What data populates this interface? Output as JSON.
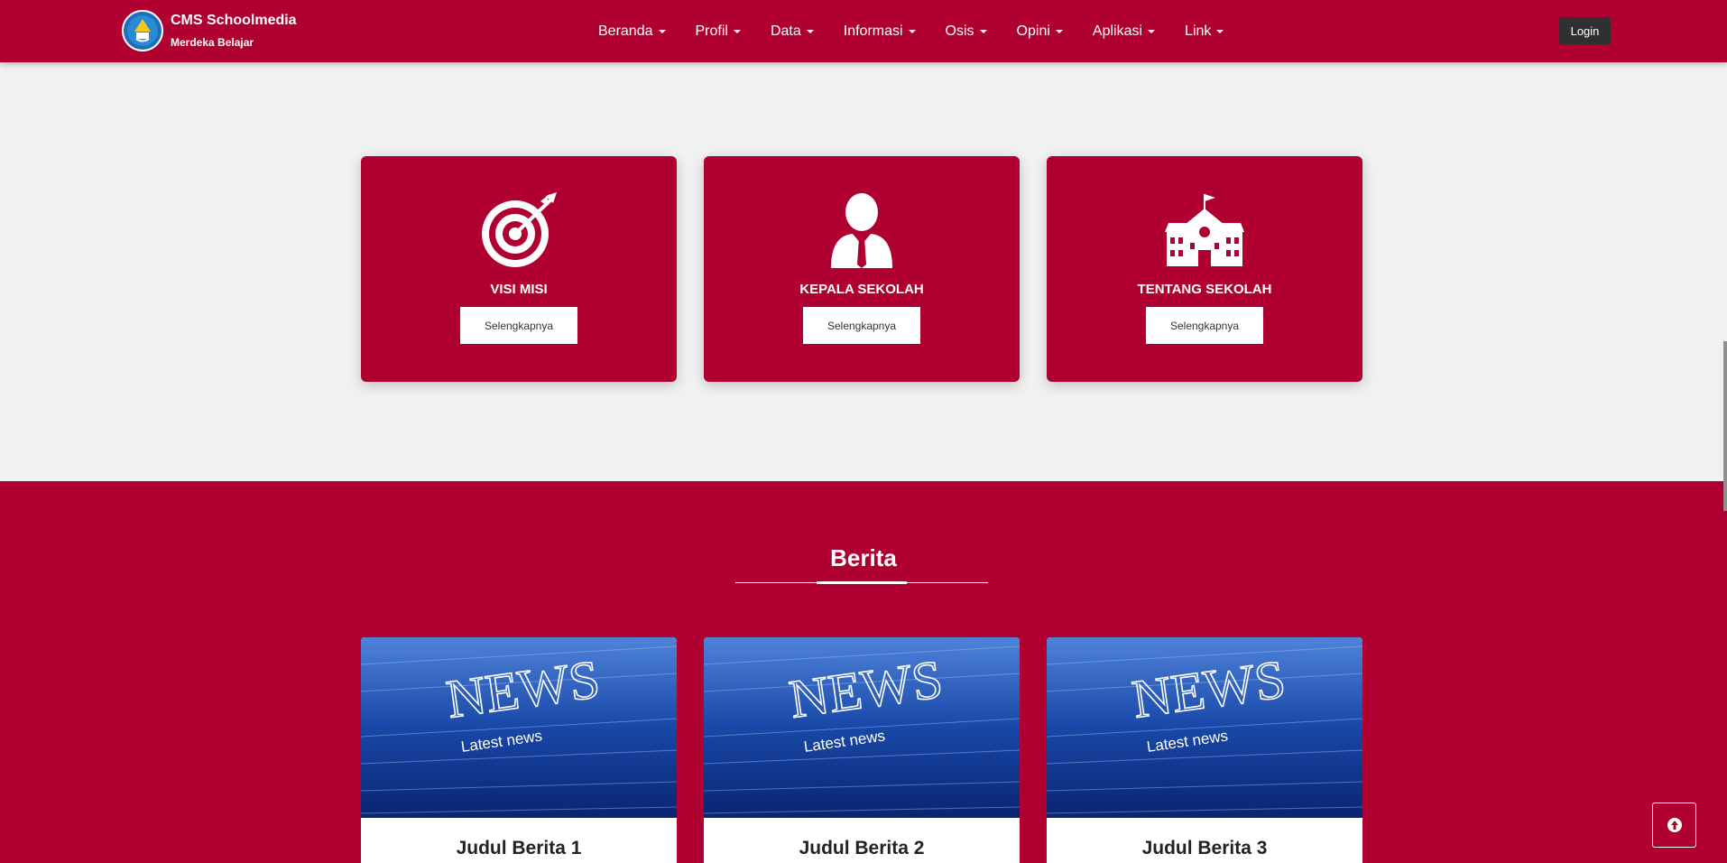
{
  "brand": {
    "title": "CMS Schoolmedia",
    "subtitle": "Merdeka Belajar"
  },
  "nav": {
    "items": [
      {
        "label": "Beranda"
      },
      {
        "label": "Profil"
      },
      {
        "label": "Data"
      },
      {
        "label": "Informasi"
      },
      {
        "label": "Osis"
      },
      {
        "label": "Opini"
      },
      {
        "label": "Aplikasi"
      },
      {
        "label": "Link"
      }
    ],
    "login_label": "Login"
  },
  "features": [
    {
      "title": "VISI MISI",
      "button": "Selengkapnya",
      "icon": "target-icon"
    },
    {
      "title": "KEPALA SEKOLAH",
      "button": "Selengkapnya",
      "icon": "person-icon"
    },
    {
      "title": "TENTANG SEKOLAH",
      "button": "Selengkapnya",
      "icon": "school-icon"
    }
  ],
  "berita": {
    "heading": "Berita",
    "items": [
      {
        "title": "Judul Berita 1"
      },
      {
        "title": "Judul Berita 2"
      },
      {
        "title": "Judul Berita 3"
      }
    ],
    "image_headline": "NEWS",
    "image_subline": "Latest news"
  },
  "colors": {
    "brand": "#b00032",
    "login_bg": "#303030"
  }
}
